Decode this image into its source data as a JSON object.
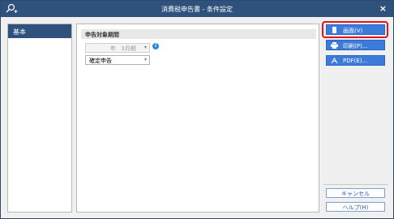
{
  "window": {
    "title": "消費税申告書 - 条件設定",
    "close_label": "×"
  },
  "sidebar": {
    "items": [
      {
        "label": "基本"
      }
    ]
  },
  "main": {
    "section_title": "申告対象期間",
    "period": {
      "year_value": "",
      "year_suffix": "年",
      "month_value": "3月期"
    },
    "report_type": {
      "selected": "確定申告"
    },
    "info_label": "i"
  },
  "buttons": {
    "screen": "画面(V)",
    "print": "印刷(P)...",
    "pdf": "PDF(E)...",
    "cancel": "キャンセル",
    "help": "ヘルプ(H)"
  },
  "colors": {
    "titlebar": "#2f527c",
    "primary": "#3d7bdb",
    "highlight": "#e4141c"
  },
  "icons": {
    "app": "search-plus-icon",
    "screen": "screen-icon",
    "print": "printer-icon",
    "pdf": "pdf-icon",
    "info": "info-icon",
    "close": "close-icon"
  }
}
